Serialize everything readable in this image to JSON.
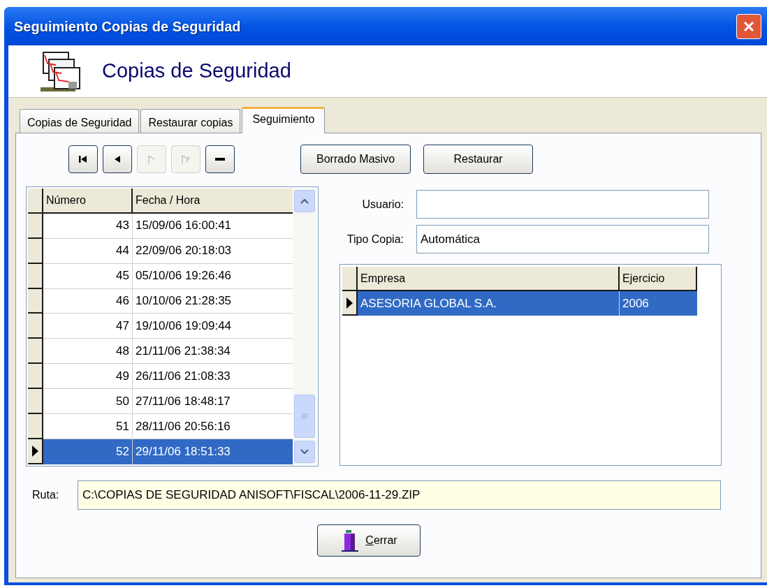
{
  "window": {
    "title": "Seguimiento Copias de Seguridad"
  },
  "header": {
    "title": "Copias de Seguridad"
  },
  "tabs": [
    {
      "label": "Copias de Seguridad",
      "selected": false
    },
    {
      "label": "Restaurar copias",
      "selected": false
    },
    {
      "label": "Seguimiento",
      "selected": true
    }
  ],
  "nav_buttons": [
    {
      "kind": "first",
      "disabled": false
    },
    {
      "kind": "prior",
      "disabled": false
    },
    {
      "kind": "next",
      "disabled": true
    },
    {
      "kind": "last",
      "disabled": true
    },
    {
      "kind": "delete",
      "disabled": false
    }
  ],
  "action_buttons": [
    "Borrado Masivo",
    "Restaurar"
  ],
  "backups_table": {
    "columns": [
      "Número",
      "Fecha / Hora"
    ],
    "rows": [
      {
        "numero": "43",
        "fecha": "15/09/06 16:00:41",
        "selected": false
      },
      {
        "numero": "44",
        "fecha": "22/09/06 20:18:03",
        "selected": false
      },
      {
        "numero": "45",
        "fecha": "05/10/06 19:26:46",
        "selected": false
      },
      {
        "numero": "46",
        "fecha": "10/10/06 21:28:35",
        "selected": false
      },
      {
        "numero": "47",
        "fecha": "19/10/06 19:09:44",
        "selected": false
      },
      {
        "numero": "48",
        "fecha": "21/11/06 21:38:34",
        "selected": false
      },
      {
        "numero": "49",
        "fecha": "26/11/06 21:08:33",
        "selected": false
      },
      {
        "numero": "50",
        "fecha": "27/11/06 18:48:17",
        "selected": false
      },
      {
        "numero": "51",
        "fecha": "28/11/06 20:56:16",
        "selected": false
      },
      {
        "numero": "52",
        "fecha": "29/11/06 18:51:33",
        "selected": true
      }
    ]
  },
  "fields": [
    {
      "label": "Usuario:"
    },
    {
      "label": "Tipo Copia:",
      "value": "Automática"
    }
  ],
  "companies_table": {
    "columns": [
      "Empresa",
      "Ejercicio"
    ],
    "rows": [
      {
        "empresa": "ASESORIA GLOBAL S.A.",
        "ejercicio": "2006",
        "selected": true
      }
    ]
  },
  "ruta": {
    "label": "Ruta:",
    "value": "C:\\COPIAS DE SEGURIDAD ANISOFT\\FISCAL\\2006-11-29.ZIP"
  },
  "close_button": {
    "label": "Cerrar"
  }
}
